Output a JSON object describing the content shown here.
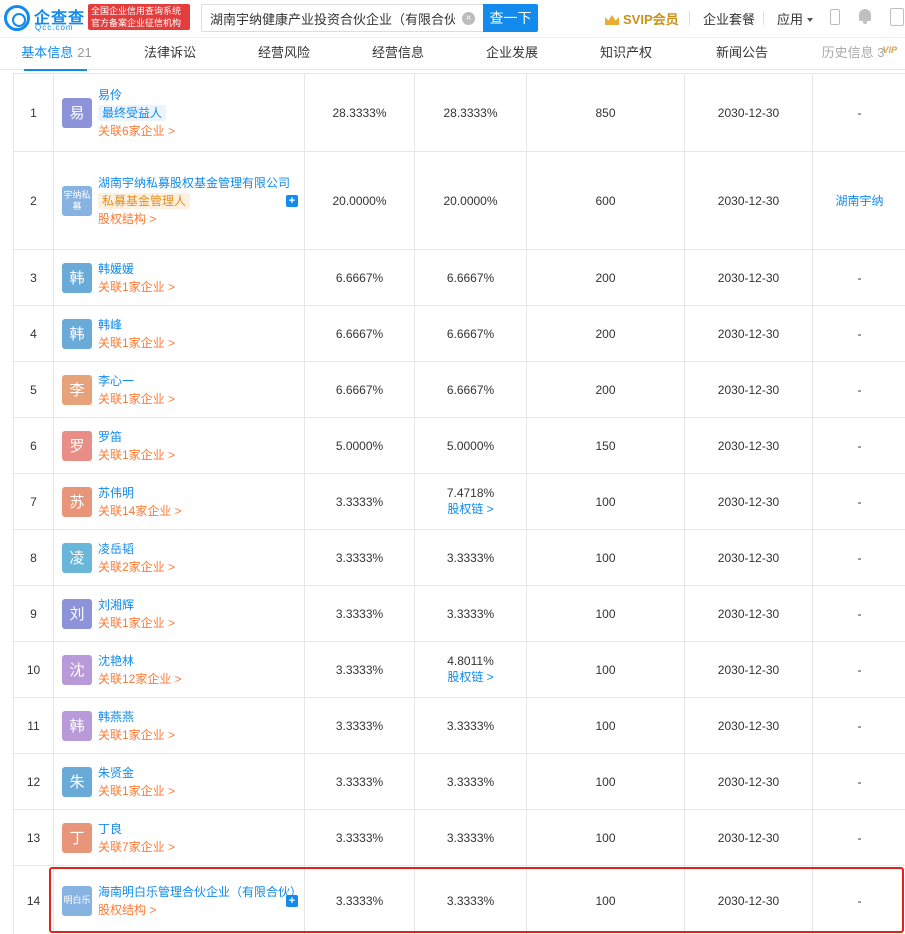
{
  "header": {
    "logo_text": "企查查",
    "logo_sub": "Qcc.com",
    "badge_line1": "全国企业信用查询系统",
    "badge_line2": "官方备案企业征信机构",
    "search_value": "湖南宇纳健康产业投资合伙企业（有限合伙）",
    "search_button": "查一下",
    "svip_label": "SVIP会员",
    "enterprise_package": "企业套餐",
    "apps_label": "应用"
  },
  "tabs": [
    {
      "label": "基本信息",
      "count": "21"
    },
    {
      "label": "法律诉讼"
    },
    {
      "label": "经营风险"
    },
    {
      "label": "经营信息"
    },
    {
      "label": "企业发展"
    },
    {
      "label": "知识产权"
    },
    {
      "label": "新闻公告"
    },
    {
      "label": "历史信息",
      "count": "3",
      "vip": "VIP"
    }
  ],
  "colors": {
    "accent": "#128bed",
    "association": "#fd7a35",
    "highlight": "#e2231a"
  },
  "rows": [
    {
      "idx": "1",
      "avatar": "易",
      "avatar_color": "#8c93d9",
      "name": "易伶",
      "tag": "最终受益人",
      "tag_type": "blue",
      "assoc": "关联6家企业 >",
      "ratio": "28.3333%",
      "ratio2": "28.3333%",
      "amount": "850",
      "date": "2030-12-30",
      "extra": "-"
    },
    {
      "idx": "2",
      "avatar": "宇纳私募",
      "avatar_color": "#87b3e3",
      "name": "湖南宇纳私募股权基金管理有限公司",
      "tag": "私募基金管理人",
      "tag_type": "orange",
      "assoc": "股权结构 >",
      "plus": "+",
      "ratio": "20.0000%",
      "ratio2": "20.0000%",
      "amount": "600",
      "date": "2030-12-30",
      "extra": "湖南宇纳"
    },
    {
      "idx": "3",
      "avatar": "韩",
      "avatar_color": "#6aaad8",
      "name": "韩媛媛",
      "assoc": "关联1家企业 >",
      "ratio": "6.6667%",
      "ratio2": "6.6667%",
      "amount": "200",
      "date": "2030-12-30",
      "extra": "-"
    },
    {
      "idx": "4",
      "avatar": "韩",
      "avatar_color": "#6aaad8",
      "name": "韩峰",
      "assoc": "关联1家企业 >",
      "ratio": "6.6667%",
      "ratio2": "6.6667%",
      "amount": "200",
      "date": "2030-12-30",
      "extra": "-"
    },
    {
      "idx": "5",
      "avatar": "李",
      "avatar_color": "#e8a27a",
      "name": "李心一",
      "assoc": "关联1家企业 >",
      "ratio": "6.6667%",
      "ratio2": "6.6667%",
      "amount": "200",
      "date": "2030-12-30",
      "extra": "-"
    },
    {
      "idx": "6",
      "avatar": "罗",
      "avatar_color": "#e88e86",
      "name": "罗笛",
      "assoc": "关联1家企业 >",
      "ratio": "5.0000%",
      "ratio2": "5.0000%",
      "amount": "150",
      "date": "2030-12-30",
      "extra": "-"
    },
    {
      "idx": "7",
      "avatar": "苏",
      "avatar_color": "#e8957a",
      "name": "苏伟明",
      "assoc": "关联14家企业 >",
      "ratio": "3.3333%",
      "ratio2": "7.4718%",
      "chain": "股权链 >",
      "amount": "100",
      "date": "2030-12-30",
      "extra": "-"
    },
    {
      "idx": "8",
      "avatar": "凌",
      "avatar_color": "#6ab6d8",
      "name": "凌岳韬",
      "assoc": "关联2家企业 >",
      "ratio": "3.3333%",
      "ratio2": "3.3333%",
      "amount": "100",
      "date": "2030-12-30",
      "extra": "-"
    },
    {
      "idx": "9",
      "avatar": "刘",
      "avatar_color": "#8c93d9",
      "name": "刘湘辉",
      "assoc": "关联1家企业 >",
      "ratio": "3.3333%",
      "ratio2": "3.3333%",
      "amount": "100",
      "date": "2030-12-30",
      "extra": "-"
    },
    {
      "idx": "10",
      "avatar": "沈",
      "avatar_color": "#b99ad9",
      "name": "沈艳林",
      "assoc": "关联12家企业 >",
      "ratio": "3.3333%",
      "ratio2": "4.8011%",
      "chain": "股权链 >",
      "amount": "100",
      "date": "2030-12-30",
      "extra": "-"
    },
    {
      "idx": "11",
      "avatar": "韩",
      "avatar_color": "#b99ad9",
      "name": "韩燕燕",
      "assoc": "关联1家企业 >",
      "ratio": "3.3333%",
      "ratio2": "3.3333%",
      "amount": "100",
      "date": "2030-12-30",
      "extra": "-"
    },
    {
      "idx": "12",
      "avatar": "朱",
      "avatar_color": "#6aaad8",
      "name": "朱贤金",
      "assoc": "关联1家企业 >",
      "ratio": "3.3333%",
      "ratio2": "3.3333%",
      "amount": "100",
      "date": "2030-12-30",
      "extra": "-"
    },
    {
      "idx": "13",
      "avatar": "丁",
      "avatar_color": "#e8957a",
      "name": "丁良",
      "assoc": "关联7家企业 >",
      "ratio": "3.3333%",
      "ratio2": "3.3333%",
      "amount": "100",
      "date": "2030-12-30",
      "extra": "-"
    },
    {
      "idx": "14",
      "avatar": "明白乐",
      "avatar_color": "#87b3e3",
      "name": "海南明白乐管理合伙企业（有限合伙）",
      "assoc": "股权结构 >",
      "plus": "+",
      "ratio": "3.3333%",
      "ratio2": "3.3333%",
      "amount": "100",
      "date": "2030-12-30",
      "extra": "-"
    }
  ]
}
